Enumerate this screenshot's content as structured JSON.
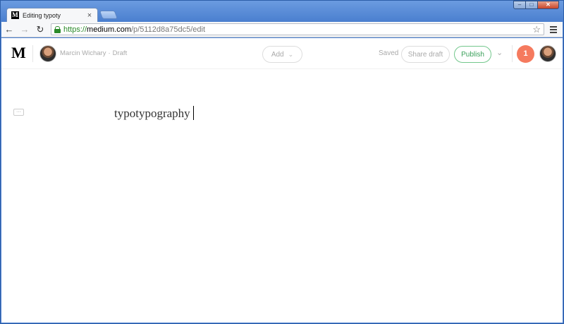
{
  "browser": {
    "tab": {
      "favicon": "M",
      "title": "Editing typoty",
      "close": "×"
    },
    "window_controls": {
      "minimize": "–",
      "maximize": "□",
      "close": "✕"
    },
    "nav": {
      "back": "←",
      "forward": "→",
      "reload": "↻"
    },
    "address": {
      "scheme": "https://",
      "host": "medium.com",
      "path": "/p/5112d8a75dc5/edit"
    },
    "star": "☆"
  },
  "header": {
    "logo": "M",
    "author": "Marcin Wichary",
    "separator": "·",
    "status": "Draft",
    "add_label": "Add",
    "add_chevron": "⌄",
    "saved_label": "Saved",
    "share_label": "Share draft",
    "publish_label": "Publish",
    "publish_chevron": "⌄",
    "notification_count": "1"
  },
  "editor": {
    "more_label": "···",
    "text": "typotypography"
  },
  "colors": {
    "publish_green": "#3aa05a",
    "notification": "#f57a5e",
    "secure_green": "#2a8a2a"
  }
}
